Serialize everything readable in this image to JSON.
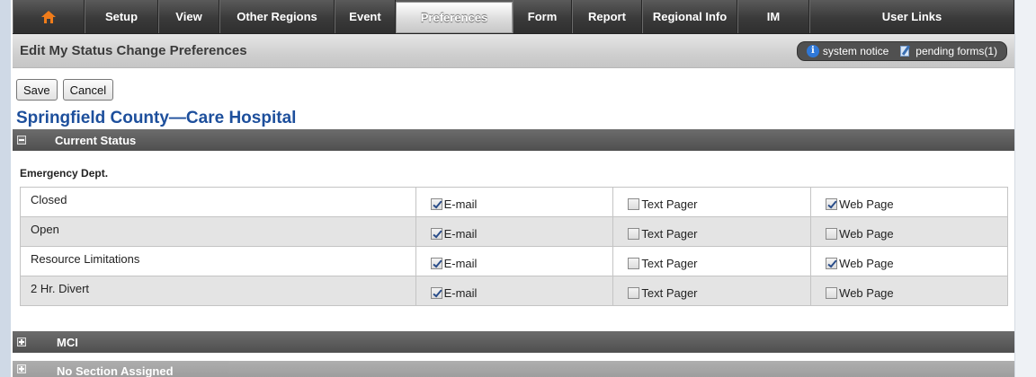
{
  "nav": {
    "home_icon": "home-icon",
    "items": [
      {
        "label": "Setup"
      },
      {
        "label": "View"
      },
      {
        "label": "Other Regions"
      },
      {
        "label": "Event"
      },
      {
        "label": "Preferences",
        "active": true
      },
      {
        "label": "Form"
      },
      {
        "label": "Report"
      },
      {
        "label": "Regional Info"
      },
      {
        "label": "IM"
      },
      {
        "label": "User Links"
      }
    ]
  },
  "header": {
    "title": "Edit My Status Change Preferences",
    "system_notice": "system notice",
    "pending_forms": "pending forms(1)"
  },
  "toolbar": {
    "save_label": "Save",
    "cancel_label": "Cancel"
  },
  "organization": "Springfield County—Care Hospital",
  "sections": {
    "current_status": "Current Status",
    "mci": "MCI",
    "no_section": "No Section Assigned"
  },
  "group": {
    "title": "Emergency Dept.",
    "option_labels": {
      "email": "E-mail",
      "pager": "Text Pager",
      "web": "Web Page"
    },
    "rows": [
      {
        "name": "Closed",
        "email": true,
        "pager": false,
        "web": true
      },
      {
        "name": "Open",
        "email": true,
        "pager": false,
        "web": false
      },
      {
        "name": "Resource Limitations",
        "email": true,
        "pager": false,
        "web": true
      },
      {
        "name": "2 Hr. Divert",
        "email": true,
        "pager": false,
        "web": false
      }
    ]
  },
  "colors": {
    "accent": "#1d4f9c",
    "nav_bg": "#3a3a3a",
    "home_icon": "#f07c1a"
  }
}
